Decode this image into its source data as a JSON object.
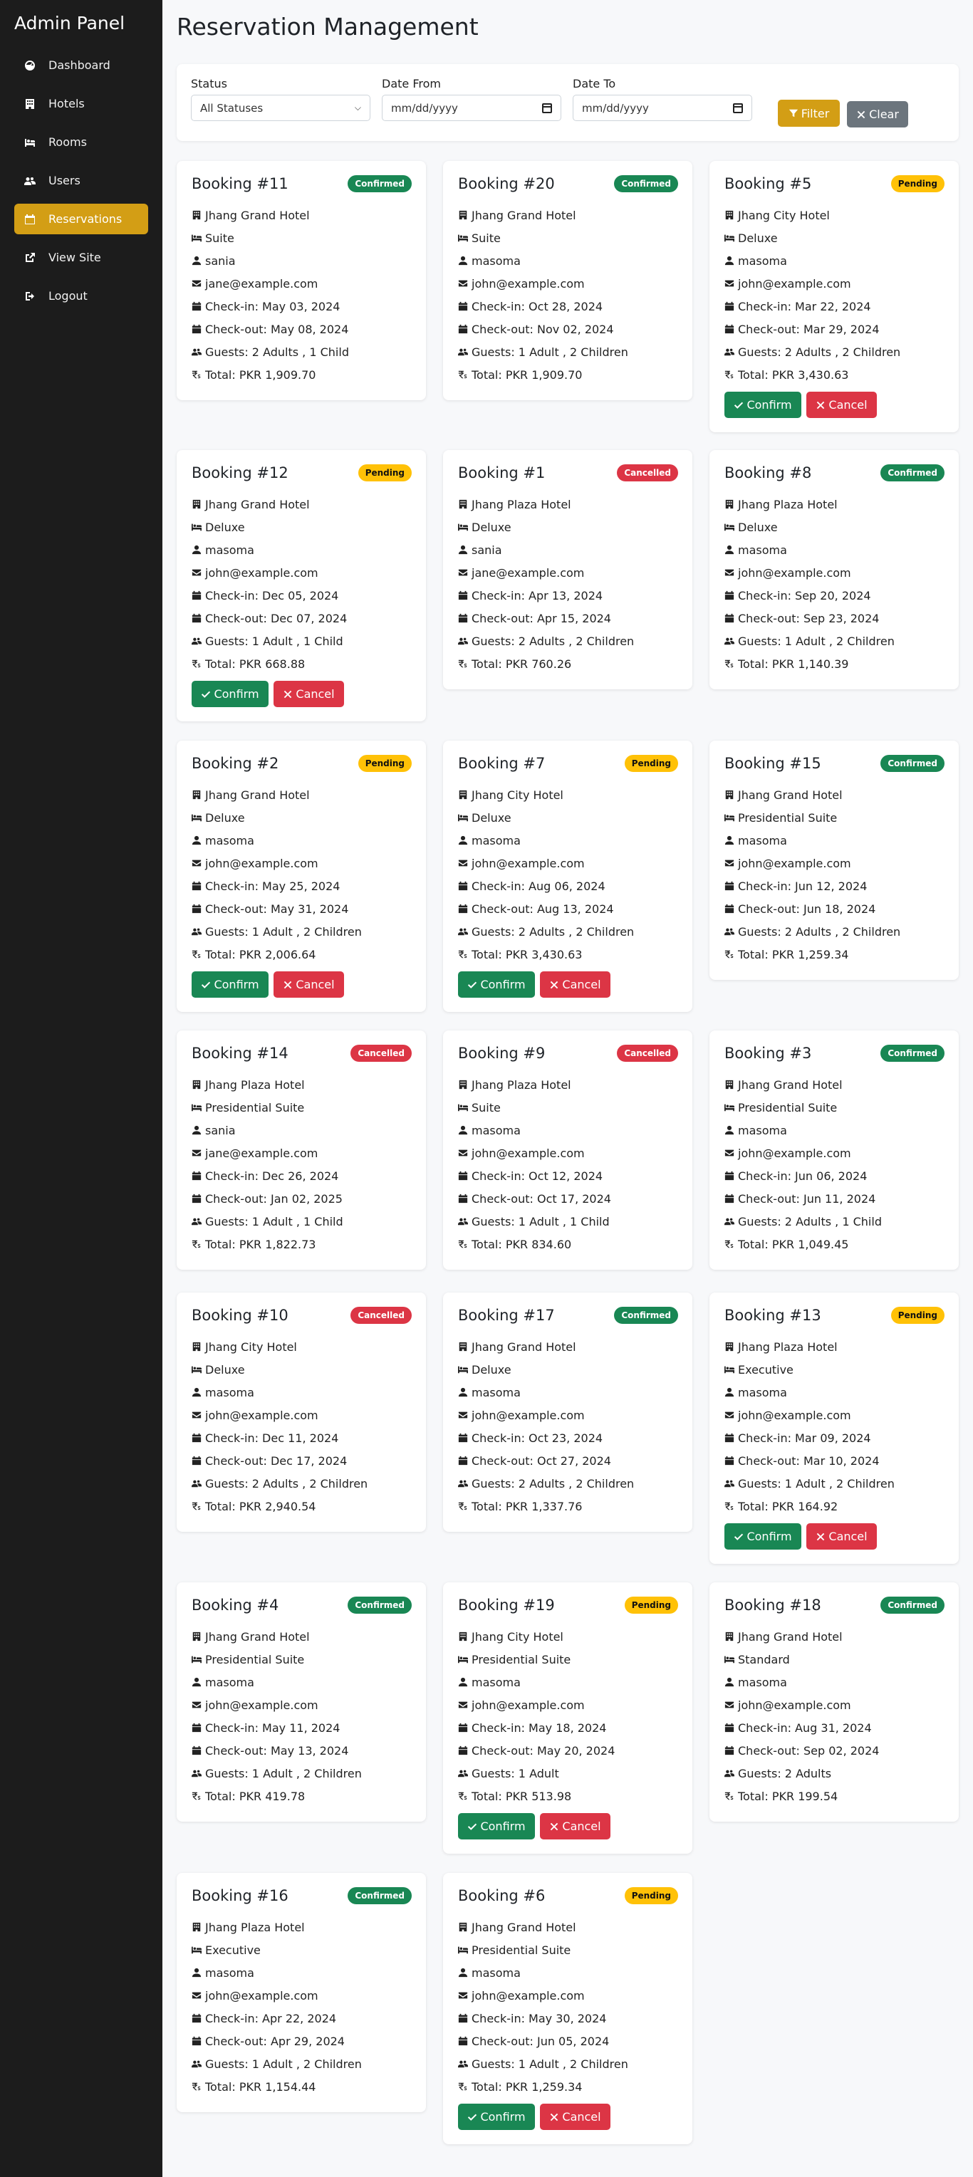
{
  "sidebar": {
    "brand": "Admin Panel",
    "items": [
      {
        "label": "Dashboard",
        "icon": "gauge-icon",
        "active": false
      },
      {
        "label": "Hotels",
        "icon": "hotel-icon",
        "active": false
      },
      {
        "label": "Rooms",
        "icon": "bed-icon",
        "active": false
      },
      {
        "label": "Users",
        "icon": "users-icon",
        "active": false
      },
      {
        "label": "Reservations",
        "icon": "calendar-icon",
        "active": true
      },
      {
        "label": "View Site",
        "icon": "external-link-icon",
        "active": false
      },
      {
        "label": "Logout",
        "icon": "logout-icon",
        "active": false
      }
    ]
  },
  "page": {
    "title": "Reservation Management"
  },
  "filters": {
    "status_label": "Status",
    "status_value": "All Statuses",
    "date_from_label": "Date From",
    "date_from_placeholder": "mm/dd/yyyy",
    "date_to_label": "Date To",
    "date_to_placeholder": "mm/dd/yyyy",
    "filter_button": "Filter",
    "clear_button": "Clear"
  },
  "labels": {
    "confirm": "Confirm",
    "cancel": "Cancel"
  },
  "colors": {
    "accent": "#d39e15",
    "confirmed": "#198754",
    "pending": "#ffc107",
    "cancelled": "#dc3545",
    "sidebar": "#1c1c1c"
  },
  "bookings": [
    {
      "title": "Booking #11",
      "status": "Confirmed",
      "hotel": "Jhang Grand Hotel",
      "room": "Suite",
      "user": "sania",
      "email": "jane@example.com",
      "checkin": "Check-in: May 03, 2024",
      "checkout": "Check-out: May 08, 2024",
      "guests": "Guests: 2 Adults , 1 Child",
      "total": "Total: PKR 1,909.70"
    },
    {
      "title": "Booking #20",
      "status": "Confirmed",
      "hotel": "Jhang Grand Hotel",
      "room": "Suite",
      "user": "masoma",
      "email": "john@example.com",
      "checkin": "Check-in: Oct 28, 2024",
      "checkout": "Check-out: Nov 02, 2024",
      "guests": "Guests: 1 Adult , 2 Children",
      "total": "Total: PKR 1,909.70"
    },
    {
      "title": "Booking #5",
      "status": "Pending",
      "hotel": "Jhang City Hotel",
      "room": "Deluxe",
      "user": "masoma",
      "email": "john@example.com",
      "checkin": "Check-in: Mar 22, 2024",
      "checkout": "Check-out: Mar 29, 2024",
      "guests": "Guests: 2 Adults , 2 Children",
      "total": "Total: PKR 3,430.63"
    },
    {
      "title": "Booking #12",
      "status": "Pending",
      "hotel": "Jhang Grand Hotel",
      "room": "Deluxe",
      "user": "masoma",
      "email": "john@example.com",
      "checkin": "Check-in: Dec 05, 2024",
      "checkout": "Check-out: Dec 07, 2024",
      "guests": "Guests: 1 Adult , 1 Child",
      "total": "Total: PKR 668.88"
    },
    {
      "title": "Booking #1",
      "status": "Cancelled",
      "hotel": "Jhang Plaza Hotel",
      "room": "Deluxe",
      "user": "sania",
      "email": "jane@example.com",
      "checkin": "Check-in: Apr 13, 2024",
      "checkout": "Check-out: Apr 15, 2024",
      "guests": "Guests: 2 Adults , 2 Children",
      "total": "Total: PKR 760.26"
    },
    {
      "title": "Booking #8",
      "status": "Confirmed",
      "hotel": "Jhang Plaza Hotel",
      "room": "Deluxe",
      "user": "masoma",
      "email": "john@example.com",
      "checkin": "Check-in: Sep 20, 2024",
      "checkout": "Check-out: Sep 23, 2024",
      "guests": "Guests: 1 Adult , 2 Children",
      "total": "Total: PKR 1,140.39"
    },
    {
      "title": "Booking #2",
      "status": "Pending",
      "hotel": "Jhang Grand Hotel",
      "room": "Deluxe",
      "user": "masoma",
      "email": "john@example.com",
      "checkin": "Check-in: May 25, 2024",
      "checkout": "Check-out: May 31, 2024",
      "guests": "Guests: 1 Adult , 2 Children",
      "total": "Total: PKR 2,006.64"
    },
    {
      "title": "Booking #7",
      "status": "Pending",
      "hotel": "Jhang City Hotel",
      "room": "Deluxe",
      "user": "masoma",
      "email": "john@example.com",
      "checkin": "Check-in: Aug 06, 2024",
      "checkout": "Check-out: Aug 13, 2024",
      "guests": "Guests: 2 Adults , 2 Children",
      "total": "Total: PKR 3,430.63"
    },
    {
      "title": "Booking #15",
      "status": "Confirmed",
      "hotel": "Jhang Grand Hotel",
      "room": "Presidential Suite",
      "user": "masoma",
      "email": "john@example.com",
      "checkin": "Check-in: Jun 12, 2024",
      "checkout": "Check-out: Jun 18, 2024",
      "guests": "Guests: 2 Adults , 2 Children",
      "total": "Total: PKR 1,259.34"
    },
    {
      "title": "Booking #14",
      "status": "Cancelled",
      "hotel": "Jhang Plaza Hotel",
      "room": "Presidential Suite",
      "user": "sania",
      "email": "jane@example.com",
      "checkin": "Check-in: Dec 26, 2024",
      "checkout": "Check-out: Jan 02, 2025",
      "guests": "Guests: 1 Adult , 1 Child",
      "total": "Total: PKR 1,822.73"
    },
    {
      "title": "Booking #9",
      "status": "Cancelled",
      "hotel": "Jhang Plaza Hotel",
      "room": "Suite",
      "user": "masoma",
      "email": "john@example.com",
      "checkin": "Check-in: Oct 12, 2024",
      "checkout": "Check-out: Oct 17, 2024",
      "guests": "Guests: 1 Adult , 1 Child",
      "total": "Total: PKR 834.60"
    },
    {
      "title": "Booking #3",
      "status": "Confirmed",
      "hotel": "Jhang Grand Hotel",
      "room": "Presidential Suite",
      "user": "masoma",
      "email": "john@example.com",
      "checkin": "Check-in: Jun 06, 2024",
      "checkout": "Check-out: Jun 11, 2024",
      "guests": "Guests: 2 Adults , 1 Child",
      "total": "Total: PKR 1,049.45"
    },
    {
      "title": "Booking #10",
      "status": "Cancelled",
      "hotel": "Jhang City Hotel",
      "room": "Deluxe",
      "user": "masoma",
      "email": "john@example.com",
      "checkin": "Check-in: Dec 11, 2024",
      "checkout": "Check-out: Dec 17, 2024",
      "guests": "Guests: 2 Adults , 2 Children",
      "total": "Total: PKR 2,940.54"
    },
    {
      "title": "Booking #17",
      "status": "Confirmed",
      "hotel": "Jhang Grand Hotel",
      "room": "Deluxe",
      "user": "masoma",
      "email": "john@example.com",
      "checkin": "Check-in: Oct 23, 2024",
      "checkout": "Check-out: Oct 27, 2024",
      "guests": "Guests: 2 Adults , 2 Children",
      "total": "Total: PKR 1,337.76"
    },
    {
      "title": "Booking #13",
      "status": "Pending",
      "hotel": "Jhang Plaza Hotel",
      "room": "Executive",
      "user": "masoma",
      "email": "john@example.com",
      "checkin": "Check-in: Mar 09, 2024",
      "checkout": "Check-out: Mar 10, 2024",
      "guests": "Guests: 1 Adult , 2 Children",
      "total": "Total: PKR 164.92"
    },
    {
      "title": "Booking #4",
      "status": "Confirmed",
      "hotel": "Jhang Grand Hotel",
      "room": "Presidential Suite",
      "user": "masoma",
      "email": "john@example.com",
      "checkin": "Check-in: May 11, 2024",
      "checkout": "Check-out: May 13, 2024",
      "guests": "Guests: 1 Adult , 2 Children",
      "total": "Total: PKR 419.78"
    },
    {
      "title": "Booking #19",
      "status": "Pending",
      "hotel": "Jhang City Hotel",
      "room": "Presidential Suite",
      "user": "masoma",
      "email": "john@example.com",
      "checkin": "Check-in: May 18, 2024",
      "checkout": "Check-out: May 20, 2024",
      "guests": "Guests: 1 Adult",
      "total": "Total: PKR 513.98"
    },
    {
      "title": "Booking #18",
      "status": "Confirmed",
      "hotel": "Jhang Grand Hotel",
      "room": "Standard",
      "user": "masoma",
      "email": "john@example.com",
      "checkin": "Check-in: Aug 31, 2024",
      "checkout": "Check-out: Sep 02, 2024",
      "guests": "Guests: 2 Adults",
      "total": "Total: PKR 199.54"
    },
    {
      "title": "Booking #16",
      "status": "Confirmed",
      "hotel": "Jhang Plaza Hotel",
      "room": "Executive",
      "user": "masoma",
      "email": "john@example.com",
      "checkin": "Check-in: Apr 22, 2024",
      "checkout": "Check-out: Apr 29, 2024",
      "guests": "Guests: 1 Adult , 2 Children",
      "total": "Total: PKR 1,154.44"
    },
    {
      "title": "Booking #6",
      "status": "Pending",
      "hotel": "Jhang Grand Hotel",
      "room": "Presidential Suite",
      "user": "masoma",
      "email": "john@example.com",
      "checkin": "Check-in: May 30, 2024",
      "checkout": "Check-out: Jun 05, 2024",
      "guests": "Guests: 1 Adult , 2 Children",
      "total": "Total: PKR 1,259.34"
    }
  ]
}
